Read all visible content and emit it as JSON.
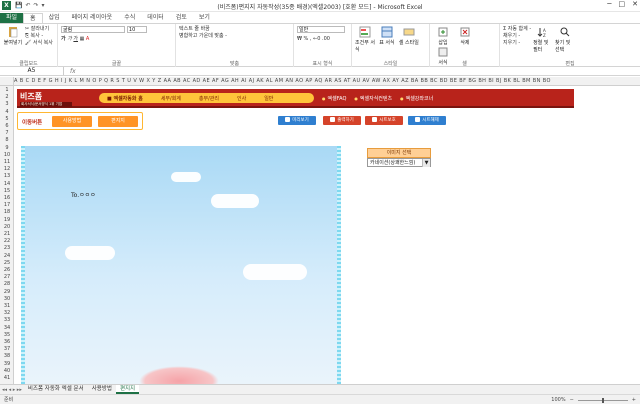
{
  "window": {
    "title": "(비즈폼)편지지 자동작성(35종 배경)(엑셀2003) [호환 모드] - Microsoft Excel",
    "app_initial": "X",
    "qat": [
      "💾",
      "↶",
      "↷",
      "▾"
    ],
    "controls": [
      "─",
      "□",
      "✕"
    ]
  },
  "tabs": [
    "파일",
    "홈",
    "삽입",
    "페이지 레이아웃",
    "수식",
    "데이터",
    "검토",
    "보기"
  ],
  "ribbon": {
    "clipboard": {
      "paste": "붙여넣기",
      "cut": "잘라내기",
      "copy": "복사 -",
      "format_painter": "서식 복사",
      "name": "클립보드"
    },
    "font": {
      "face": "굴림",
      "size": "10",
      "name": "글꼴"
    },
    "alignment": {
      "wrap": "텍스트 줄 바꿈",
      "merge": "병합하고 가운데 맞춤 -",
      "name": "맞춤"
    },
    "number": {
      "format": "일반",
      "name": "표시 형식"
    },
    "styles": {
      "cond": "조건부 서식",
      "table": "표 서식",
      "cell": "셀 스타일",
      "name": "스타일"
    },
    "cells": {
      "insert": "삽입",
      "delete": "삭제",
      "format": "서식",
      "name": "셀"
    },
    "editing": {
      "autosum": "Σ 자동 합계 -",
      "fill": "채우기 -",
      "clear": "지우기 -",
      "sort": "정렬 및 필터",
      "find": "찾기 및 선택",
      "name": "편집"
    }
  },
  "formula_bar": {
    "name_box": "A5",
    "fx": "fx",
    "content": ""
  },
  "columns": "A B C D E F G H I J K L M N O P Q R S T U V W X Y Z AA AB AC AD AE AF AG AH AI AJ AK AL AM AN AO AP AQ AR AS AT AU AV AW AX AY AZ BA BB BC BD BE BF BG BH BI BJ BK BL BM BN BO",
  "rows": [
    "1",
    "2",
    "3",
    "4",
    "5",
    "6",
    "7",
    "8",
    "9",
    "10",
    "11",
    "12",
    "13",
    "14",
    "15",
    "16",
    "17",
    "18",
    "19",
    "20",
    "21",
    "22",
    "23",
    "24",
    "25",
    "26",
    "27",
    "28",
    "29",
    "30",
    "31",
    "32",
    "33",
    "34",
    "35",
    "36",
    "37",
    "38",
    "39",
    "40",
    "41"
  ],
  "banner": {
    "logo": "비즈폼",
    "logo_sub": "회사서식/문서양식 1위 기업",
    "nav": [
      "엑셀자동화 홈",
      "세무/회계",
      "총무/관리",
      "인사",
      "일반"
    ],
    "links": [
      "엑셀FAQ",
      "엑셀자식컨텐츠",
      "엑셀강좌코너"
    ]
  },
  "side": {
    "label": "이동버튼",
    "usage": "사용방법",
    "letter": "편지지"
  },
  "actions": {
    "preview": "미리보기",
    "print": "출력하기",
    "protect": "시트보호",
    "unprotect": "시트해제"
  },
  "letter": {
    "to": "To.ㅇㅇㅇ"
  },
  "image_select": {
    "header": "이미지 선택",
    "value": "카네이션(상쾌한느낌)"
  },
  "sheet_tabs": [
    "비즈폼 자동화 엑셀 문서",
    "사용방법",
    "편지지"
  ],
  "status": {
    "ready": "준비",
    "zoom": "100%"
  }
}
